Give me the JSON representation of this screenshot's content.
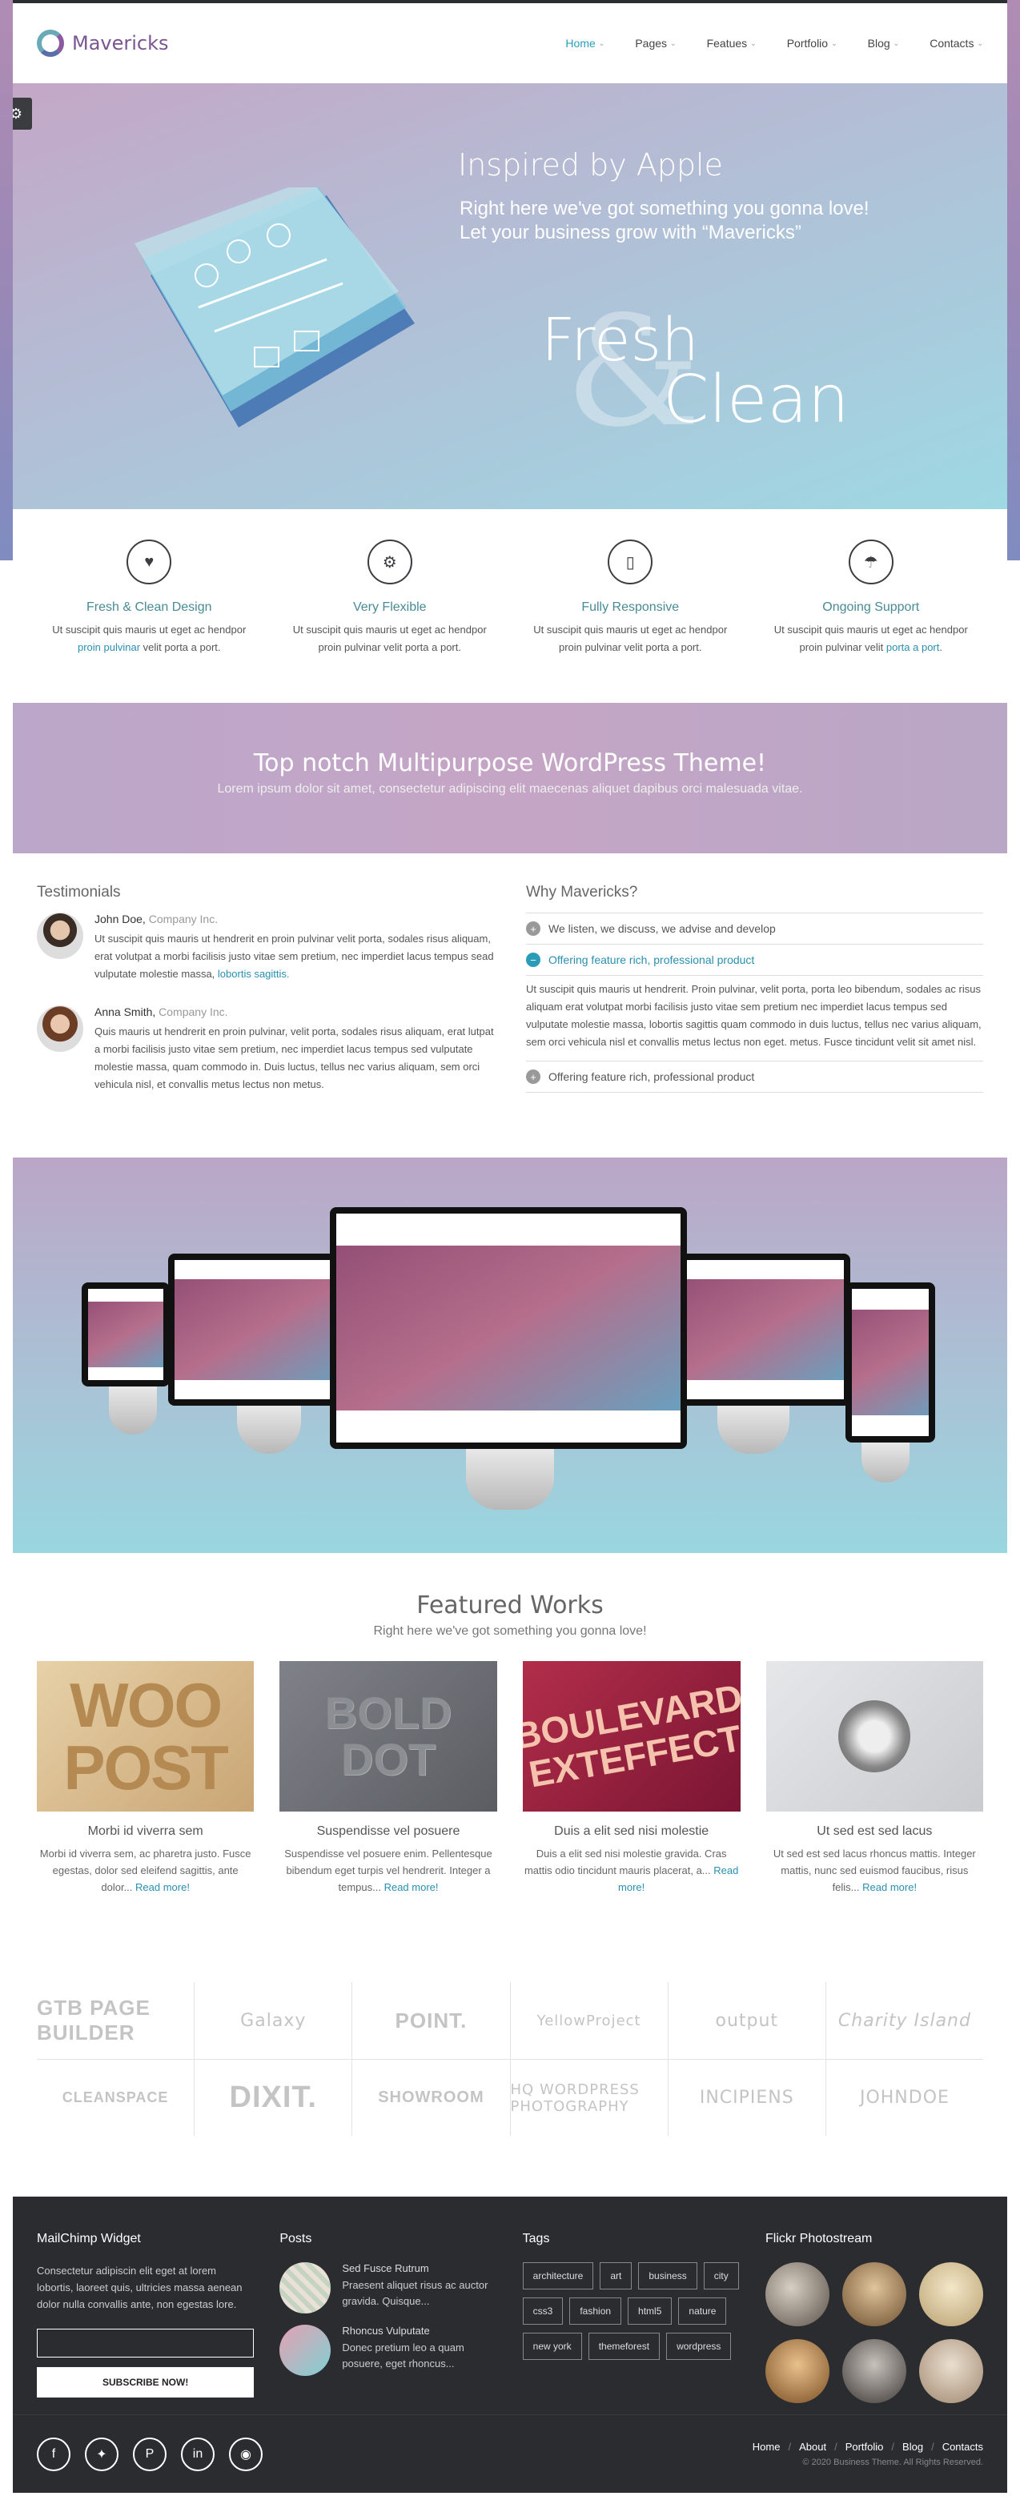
{
  "header": {
    "logo": "Mavericks",
    "nav": [
      "Home",
      "Pages",
      "Featues",
      "Portfolio",
      "Blog",
      "Contacts"
    ]
  },
  "hero": {
    "title": "Inspired by Apple",
    "sub1": "Right here we've got something you gonna love!",
    "sub2": "Let your business grow with “Mavericks”",
    "fresh": "Fresh",
    "amp": "&",
    "clean": "Clean"
  },
  "features": [
    {
      "title": "Fresh & Clean Design",
      "text": "Ut suscipit quis mauris ut eget ac hendpor",
      "link": "proin pulvinar",
      "tail": "velit porta a port."
    },
    {
      "title": "Very Flexible",
      "text": "Ut suscipit quis mauris ut eget ac hendpor proin pulvinar velit porta a port."
    },
    {
      "title": "Fully Responsive",
      "text": "Ut suscipit quis mauris ut eget ac hendpor proin pulvinar velit porta a port."
    },
    {
      "title": "Ongoing Support",
      "text": "Ut suscipit quis mauris ut eget ac hendpor proin pulvinar velit",
      "link": "porta a port",
      "tail": "."
    }
  ],
  "banner": {
    "title": "Top notch Multipurpose WordPress Theme!",
    "text": "Lorem ipsum dolor sit amet, consectetur adipiscing elit maecenas aliquet dapibus orci malesuada vitae."
  },
  "testimonials": {
    "title": "Testimonials",
    "items": [
      {
        "name": "John Doe,",
        "company": "Company Inc.",
        "text": "Ut suscipit quis mauris ut hendrerit en proin pulvinar velit porta, sodales risus aliquam, erat volutpat a morbi facilisis justo vitae sem pretium, nec imperdiet lacus tempus sead vulputate molestie massa,",
        "link": "lobortis sagittis."
      },
      {
        "name": "Anna Smith,",
        "company": "Company Inc.",
        "text": "Quis mauris ut hendrerit en proin pulvinar, velit porta, sodales risus aliquam, erat lutpat a morbi facilisis justo vitae sem pretium, nec imperdiet lacus tempus sed vulputate molestie massa, quam commodo in. Duis luctus, tellus nec varius aliquam, sem orci vehicula nisl, et convallis metus lectus non metus."
      }
    ]
  },
  "why": {
    "title": "Why Mavericks?",
    "items": [
      "We listen, we discuss, we advise and develop",
      "Offering feature rich, professional product",
      "Offering feature rich, professional product"
    ],
    "body": "Ut suscipit quis mauris ut hendrerit. Proin pulvinar, velit porta, porta leo bibendum, sodales ac risus aliquam erat volutpat morbi facilisis justo vitae sem pretium nec imperdiet lacus tempus sed vulputate molestie massa, lobortis sagittis quam commodo in duis luctus, tellus nec varius aliquam, sem orci vehicula nisl et convallis metus lectus non eget. metus. Fusce tincidunt velit sit amet nisl."
  },
  "works": {
    "title": "Featured Works",
    "subtitle": "Right here we've got something you gonna love!",
    "items": [
      {
        "art": "WOO POST",
        "title": "Morbi id viverra sem",
        "text": "Morbi id viverra sem, ac pharetra justo. Fusce egestas, dolor sed eleifend sagittis, ante dolor...",
        "more": "Read more!"
      },
      {
        "art": "BOLD DOT",
        "title": "Suspendisse vel posuere",
        "text": "Suspendisse vel posuere enim. Pellentesque bibendum eget turpis vel hendrerit. Integer a tempus...",
        "more": "Read more!"
      },
      {
        "art": "BOULEVARD EXTEFFECT",
        "title": "Duis a elit sed nisi molestie",
        "text": "Duis a elit sed nisi molestie gravida. Cras mattis odio tincidunt mauris placerat, a...",
        "more": "Read more!"
      },
      {
        "title": "Ut sed est sed lacus",
        "text": "Ut sed est sed lacus rhoncus mattis. Integer mattis, nunc sed euismod faucibus, risus felis...",
        "more": "Read more!"
      }
    ]
  },
  "clients": [
    "GTB PAGE BUILDER",
    "Galaxy",
    "POINT.",
    "YellowProject",
    "output",
    "Charity Island",
    "CLEANSPACE",
    "DIXIT.",
    "SHOWROOM",
    "HQ WORDPRESS PHOTOGRAPHY",
    "INCIPIENS",
    "JOHNDOE"
  ],
  "footer": {
    "mailchimp": {
      "title": "MailChimp Widget",
      "text": "Consectetur adipiscin elit eget at lorem lobortis, laoreet quis, ultricies massa aenean dolor nulla convallis ante, non egestas lore.",
      "button": "SUBSCRIBE NOW!"
    },
    "posts": {
      "title": "Posts",
      "items": [
        {
          "title": "Sed Fusce Rutrum",
          "text": "Praesent aliquet risus ac auctor gravida. Quisque..."
        },
        {
          "title": "Rhoncus Vulputate",
          "text": "Donec pretium leo a quam posuere, eget rhoncus..."
        }
      ]
    },
    "tags": {
      "title": "Tags",
      "items": [
        "architecture",
        "art",
        "business",
        "city",
        "css3",
        "fashion",
        "html5",
        "nature",
        "new york",
        "themeforest",
        "wordpress"
      ]
    },
    "flickr": {
      "title": "Flickr Photostream"
    },
    "links": [
      "Home",
      "About",
      "Portfolio",
      "Blog",
      "Contacts"
    ],
    "copyright": "© 2020 Business Theme. All Rights Reserved."
  },
  "colors": {
    "accent": "#2a9cb8",
    "footer_bg": "#2b2c30",
    "logo": "#7a5690"
  }
}
